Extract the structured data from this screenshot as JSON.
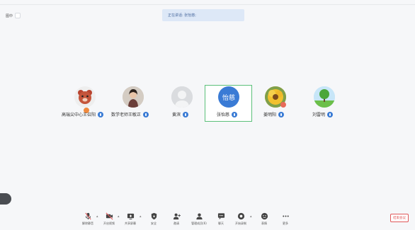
{
  "recording": {
    "label": "图中"
  },
  "banner": {
    "text": "正在讲话: 张怡慈;"
  },
  "participants": [
    {
      "name": "高瑞尖中心王召阳",
      "avatar_type": "bear-avatar",
      "has_speaker_badge": true
    },
    {
      "name": "数学老师王敏正",
      "avatar_type": "photo-avatar",
      "has_speaker_badge": false
    },
    {
      "name": "黄滨",
      "avatar_type": "default-person-avatar",
      "has_speaker_badge": false
    },
    {
      "name": "张怡慈",
      "avatar_type": "text-avatar",
      "avatar_text": "怡慈",
      "active": true
    },
    {
      "name": "姜明阳",
      "avatar_type": "sunflower-avatar",
      "has_speaker_badge": true
    },
    {
      "name": "刘雷明",
      "avatar_type": "tree-avatar",
      "has_speaker_badge": false
    }
  ],
  "toolbar": {
    "items": [
      {
        "label": "解除静音",
        "icon": "mic-muted-icon",
        "has_caret": true
      },
      {
        "label": "开启视频",
        "icon": "video-off-icon",
        "has_caret": true
      },
      {
        "label": "共享屏幕",
        "icon": "screen-share-icon",
        "has_caret": true
      },
      {
        "label": "安全",
        "icon": "shield-icon",
        "has_caret": false
      },
      {
        "label": "邀请",
        "icon": "add-person-icon",
        "has_caret": false
      },
      {
        "label": "管理成员(6)",
        "icon": "members-icon",
        "has_caret": false
      },
      {
        "label": "聊天",
        "icon": "chat-icon",
        "has_caret": false
      },
      {
        "label": "开始录制",
        "icon": "record-icon",
        "has_caret": true
      },
      {
        "label": "表情",
        "icon": "emoji-icon",
        "has_caret": false
      },
      {
        "label": "更多",
        "icon": "more-icon",
        "has_caret": false
      }
    ],
    "end_label": "结束会议"
  },
  "colors": {
    "accent": "#3a7bd5",
    "active_border": "#5cc07a",
    "end": "#e0585a",
    "banner_bg": "#dde8f7"
  }
}
